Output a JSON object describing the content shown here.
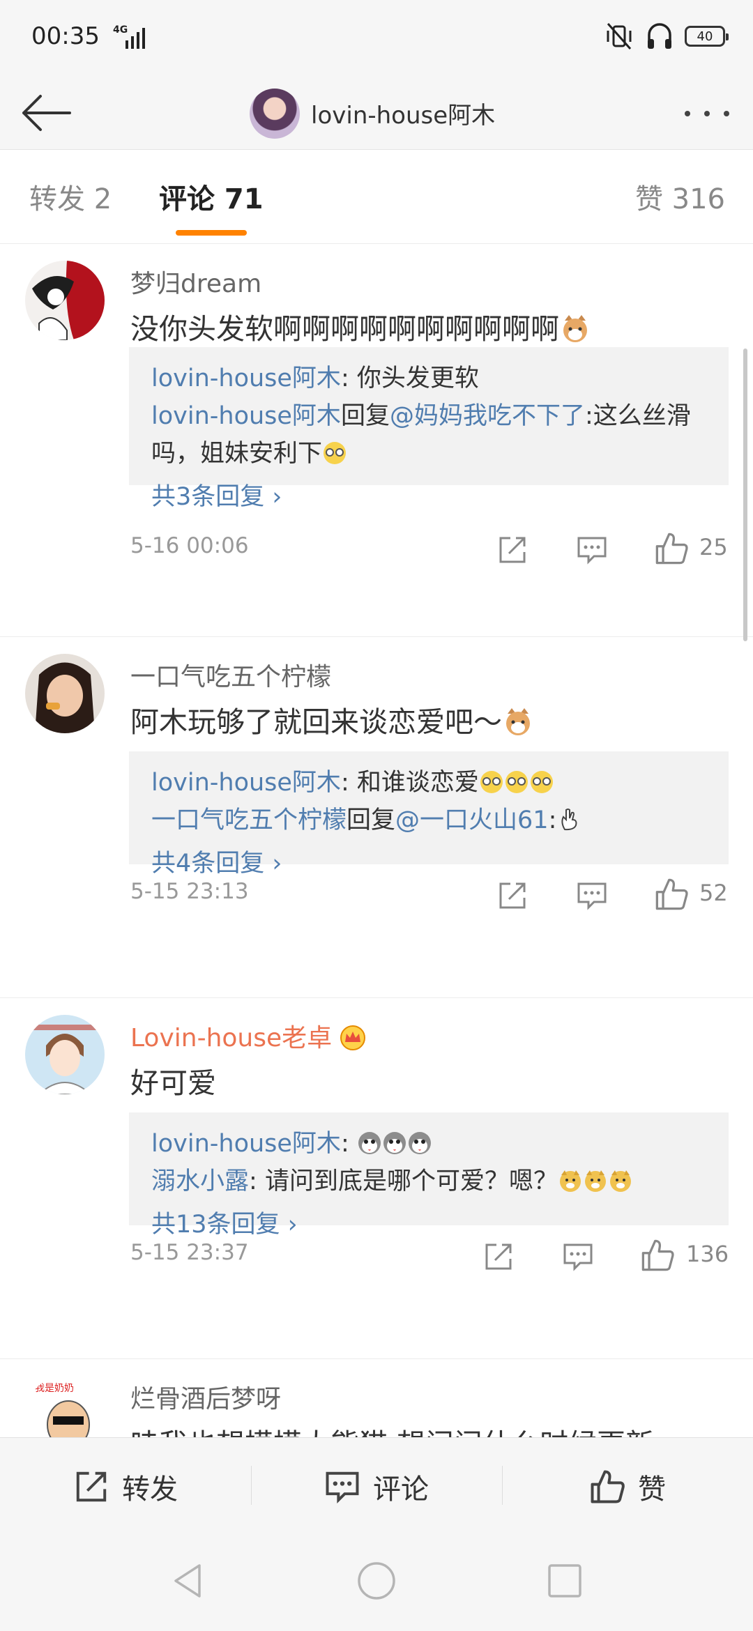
{
  "status_bar": {
    "time": "00:35",
    "network": "4G",
    "battery": "40"
  },
  "header": {
    "title": "lovin-house阿木"
  },
  "tabs": {
    "repost": "转发 2",
    "comment": "评论 71",
    "like": "赞 316"
  },
  "comments": [
    {
      "name": "梦归dream",
      "text": "没你头发软啊啊啊啊啊啊啊啊啊啊",
      "replies": [
        {
          "user": "lovin-house阿木",
          "sep": ": ",
          "text": "你头发更软"
        },
        {
          "user": "lovin-house阿木",
          "mid": "回复",
          "at": "@妈妈我吃不下了",
          "text": ":这么丝滑吗，姐妹安利下"
        }
      ],
      "more": "共3条回复 ›",
      "time": "5-16 00:06",
      "likes": "25"
    },
    {
      "name": "一口气吃五个柠檬",
      "text": "阿木玩够了就回来谈恋爱吧～",
      "replies": [
        {
          "user": "lovin-house阿木",
          "sep": ": ",
          "text": "和谁谈恋爱"
        },
        {
          "user": "一口气吃五个柠檬",
          "mid": "回复",
          "at": "@一口火山61",
          "text": ":"
        }
      ],
      "more": "共4条回复 ›",
      "time": "5-15 23:13",
      "likes": "52"
    },
    {
      "name": "Lovin-house老卓",
      "text": "好可爱",
      "replies": [
        {
          "user": "lovin-house阿木",
          "sep": ": ",
          "text": ""
        },
        {
          "user": "溺水小露",
          "sep": ": ",
          "text": "请问到底是哪个可爱？嗯？"
        }
      ],
      "more": "共13条回复 ›",
      "time": "5-15 23:37",
      "likes": "136"
    },
    {
      "name": "烂骨酒后梦呀",
      "text": "哇我也想摸摸大熊猫 想问问什么时候更新"
    }
  ],
  "toolbar": {
    "repost": "转发",
    "comment": "评论",
    "like": "赞"
  },
  "icons": {
    "back": "arrow-left-icon",
    "more": "more-dots-icon",
    "share": "share-icon",
    "comment": "comment-icon",
    "like": "thumbs-up-icon",
    "crown": "crown-icon"
  },
  "colors": {
    "accent": "#ff8200",
    "link": "#507daf",
    "vip_name": "#eb7350"
  }
}
